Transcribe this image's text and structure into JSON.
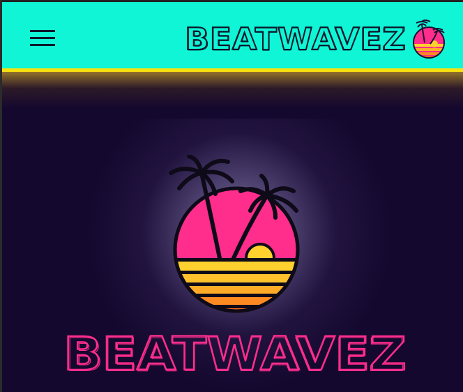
{
  "header": {
    "brand_name": "BEATWAVEZ",
    "colors": {
      "background": "#0ff5d6",
      "accent_border": "#f7e20f",
      "brand_text": "#0d1a2c"
    }
  },
  "hero": {
    "title": "BEATWAVEZ",
    "colors": {
      "background": "#15082e",
      "title": "#ff2d8c",
      "sun": "#ff2d8c",
      "stripes": [
        "#ffd12e",
        "#ffb12a",
        "#ff8a22",
        "#ff6a1a"
      ]
    }
  },
  "icons": {
    "menu": "hamburger-menu-icon",
    "logo": "palm-sunset-logo-icon"
  }
}
